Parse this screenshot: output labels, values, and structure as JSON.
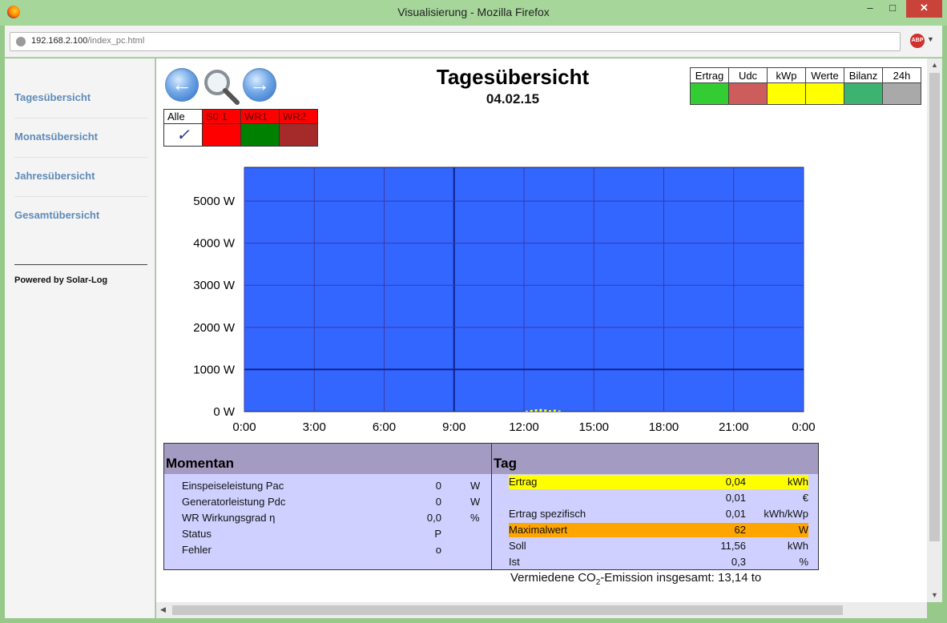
{
  "window": {
    "title": "Visualisierung - Mozilla Firefox",
    "min": "–",
    "max": "□",
    "close": "✕"
  },
  "browser": {
    "url_host": "192.168.2.100",
    "url_path": "/index_pc.html",
    "adblock": "ABP"
  },
  "sidebar": {
    "items": [
      {
        "label": "Tagesübersicht"
      },
      {
        "label": "Monatsübersicht"
      },
      {
        "label": "Jahresübersicht"
      },
      {
        "label": "Gesamtübersicht"
      }
    ],
    "powered": "Powered by Solar-Log"
  },
  "header": {
    "title": "Tagesübersicht",
    "date": "04.02.15",
    "prev": "←",
    "next": "→"
  },
  "selector": {
    "items": [
      {
        "label": "Alle",
        "color": "#ffffff",
        "text_color": "#000000",
        "swatch": "#ffffff",
        "check": "✓"
      },
      {
        "label": "S0 1",
        "color": "#ff0000",
        "text_color": "#660000",
        "swatch": "#ff0000"
      },
      {
        "label": "WR1",
        "color": "#ff0000",
        "text_color": "#660000",
        "swatch": "#008000"
      },
      {
        "label": "WR2",
        "color": "#ff0000",
        "text_color": "#660000",
        "swatch": "#a52a2a"
      }
    ]
  },
  "legend": {
    "items": [
      {
        "label": "Ertrag",
        "color": "#33cc33"
      },
      {
        "label": "Udc",
        "color": "#cd5c5c"
      },
      {
        "label": "kWp",
        "color": "#ffff00"
      },
      {
        "label": "Werte",
        "color": "#ffff00"
      },
      {
        "label": "Bilanz",
        "color": "#3cb371"
      },
      {
        "label": "24h",
        "color": "#a9a9a9"
      }
    ]
  },
  "chart_data": {
    "type": "area",
    "x_tick_labels": [
      "0:00",
      "3:00",
      "6:00",
      "9:00",
      "12:00",
      "15:00",
      "18:00",
      "21:00",
      "0:00"
    ],
    "y_tick_labels": [
      "0 W",
      "1000 W",
      "2000 W",
      "3000 W",
      "4000 W",
      "5000 W"
    ],
    "y_ticks": [
      0,
      1000,
      2000,
      3000,
      4000,
      5000
    ],
    "xlim": [
      0,
      24
    ],
    "ylim": [
      0,
      5800
    ],
    "grid": true,
    "background": "#3366ff",
    "series": [
      {
        "color": "#ffff00",
        "x": [
          12.1,
          12.3,
          12.5,
          12.7,
          12.9,
          13.1,
          13.3,
          13.5
        ],
        "y": [
          20,
          40,
          55,
          62,
          50,
          35,
          45,
          25
        ]
      }
    ]
  },
  "momentan": {
    "title": "Momentan",
    "rows": [
      {
        "label": "Einspeiseleistung Pac",
        "value": "0",
        "unit": "W"
      },
      {
        "label": "Generatorleistung Pdc",
        "value": "0",
        "unit": "W"
      },
      {
        "label": "WR Wirkungsgrad η",
        "value": "0,0",
        "unit": "%"
      },
      {
        "label": "Status",
        "value": "P",
        "unit": ""
      },
      {
        "label": "Fehler",
        "value": "o",
        "unit": ""
      }
    ]
  },
  "tag": {
    "title": "Tag",
    "rows": [
      {
        "label": "Ertrag",
        "value": "0,04",
        "unit": "kWh",
        "highlight": "#ffff00"
      },
      {
        "label": "",
        "value": "0,01",
        "unit": "€",
        "highlight": ""
      },
      {
        "label": "Ertrag spezifisch",
        "value": "0,01",
        "unit": "kWh/kWp",
        "highlight": ""
      },
      {
        "label": "Maximalwert",
        "value": "62",
        "unit": "W",
        "highlight": "#ffa500"
      },
      {
        "label": "Soll",
        "value": "11,56",
        "unit": "kWh",
        "highlight": ""
      },
      {
        "label": "Ist",
        "value": "0,3",
        "unit": "%",
        "highlight": ""
      }
    ]
  },
  "co2": {
    "prefix": "Vermiedene CO",
    "sub": "2",
    "suffix": "-Emission insgesamt: 13,14 to"
  }
}
